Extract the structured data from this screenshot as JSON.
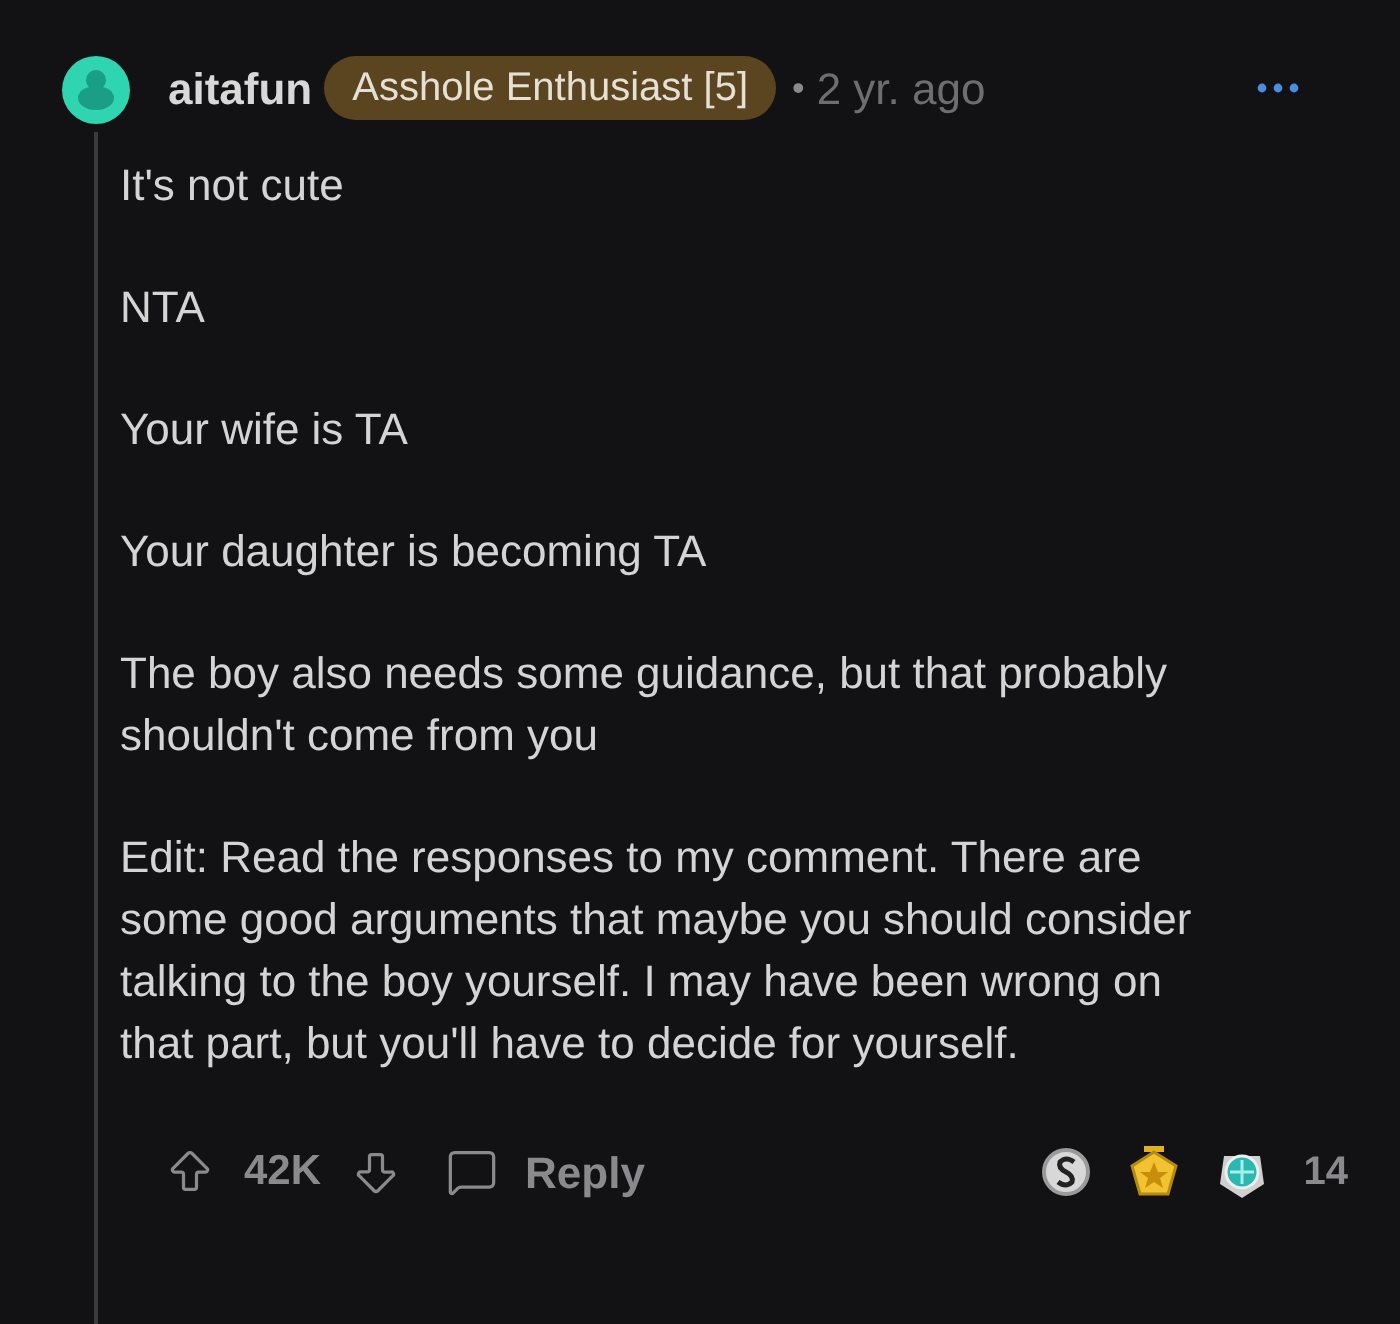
{
  "comment": {
    "author": "aitafun",
    "flair": "Asshole Enthusiast [5]",
    "separator": "•",
    "time": "2 yr. ago",
    "paragraphs": [
      "It's not cute",
      "NTA",
      "Your wife is TA",
      "Your daughter is becoming TA",
      "The boy also needs some guidance, but that probably shouldn't come from you",
      "Edit: Read the responses to my comment. There are some good arguments that maybe you should consider talking to the boy yourself. I may have been wrong on that part, but you'll have to decide for yourself."
    ],
    "score": "42K",
    "reply": "Reply",
    "awards": [
      {
        "kind": "silver"
      },
      {
        "kind": "gold"
      },
      {
        "kind": "platinum"
      }
    ],
    "award_count": "14"
  }
}
